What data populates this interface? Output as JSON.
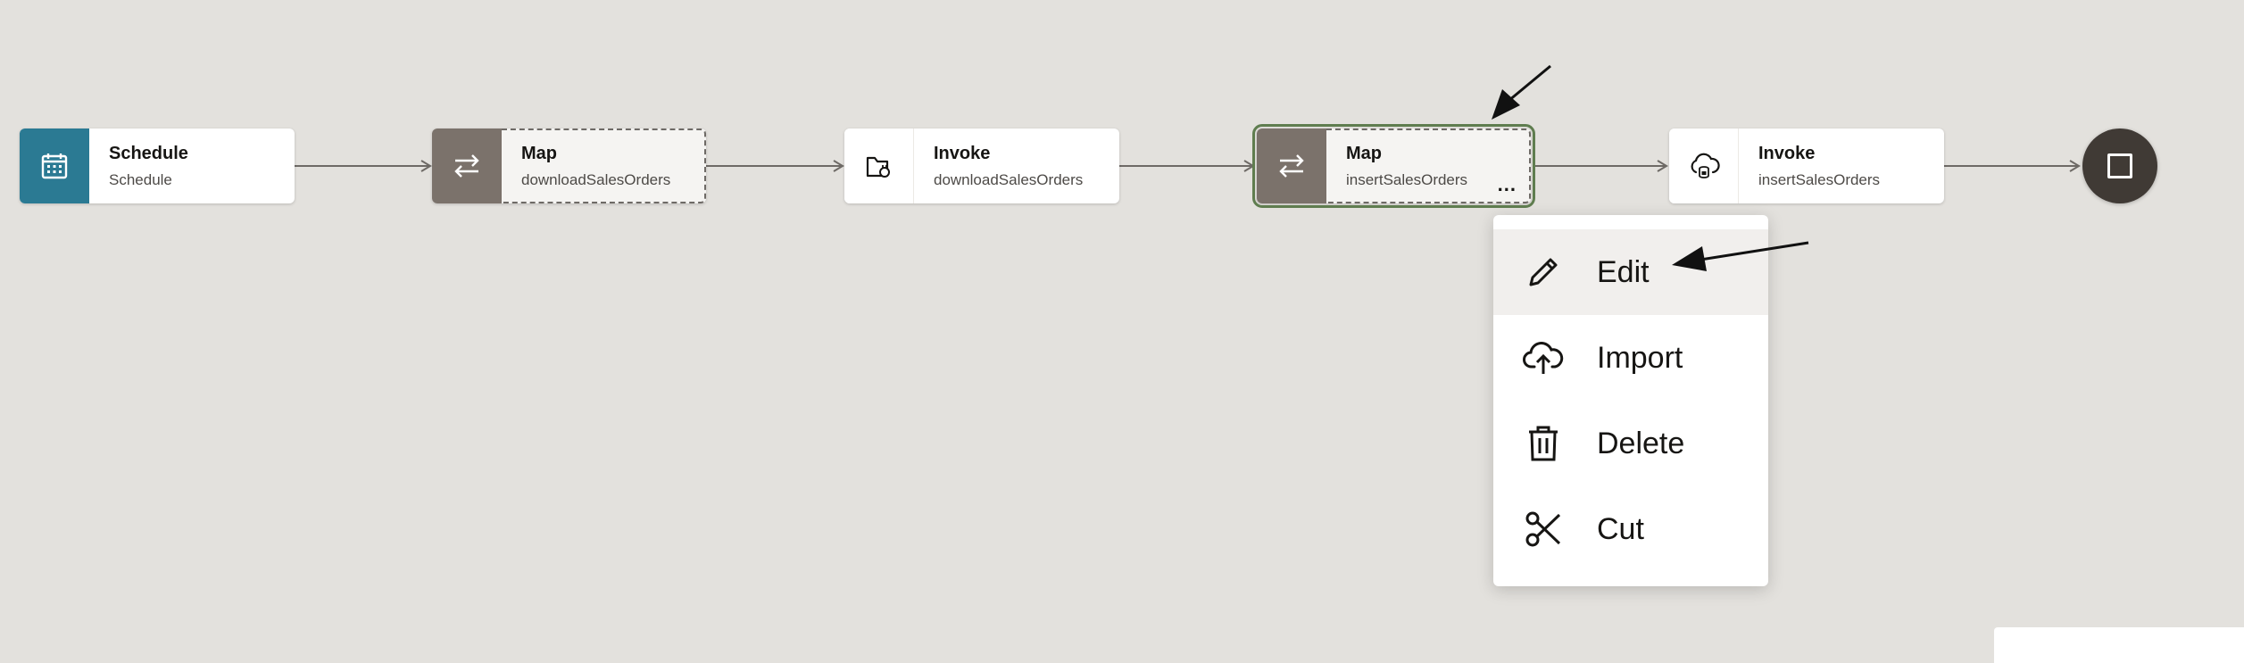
{
  "canvas": {
    "background": "#e3e1dd",
    "accent_teal": "#2b7a93",
    "map_gray": "#7b726b",
    "selection_green": "#5f7d4f",
    "end_node_color": "#403a35"
  },
  "flow": {
    "nodes": [
      {
        "id": "schedule",
        "title": "Schedule",
        "subtitle": "Schedule",
        "icon": "calendar-icon"
      },
      {
        "id": "map-download",
        "title": "Map",
        "subtitle": "downloadSalesOrders",
        "icon": "swap-arrows-icon"
      },
      {
        "id": "invoke-download",
        "title": "Invoke",
        "subtitle": "downloadSalesOrders",
        "icon": "folder-plug-icon"
      },
      {
        "id": "map-insert",
        "title": "Map",
        "subtitle": "insertSalesOrders",
        "icon": "swap-arrows-icon",
        "selected": true,
        "more": "..."
      },
      {
        "id": "invoke-insert",
        "title": "Invoke",
        "subtitle": "insertSalesOrders",
        "icon": "cloud-database-icon"
      }
    ],
    "end_node": {
      "icon": "stop-square-icon"
    }
  },
  "context_menu": {
    "items": [
      {
        "label": "Edit",
        "icon": "pencil-icon",
        "highlighted": true
      },
      {
        "label": "Import",
        "icon": "cloud-upload-icon"
      },
      {
        "label": "Delete",
        "icon": "trash-icon"
      },
      {
        "label": "Cut",
        "icon": "scissors-icon"
      }
    ]
  }
}
